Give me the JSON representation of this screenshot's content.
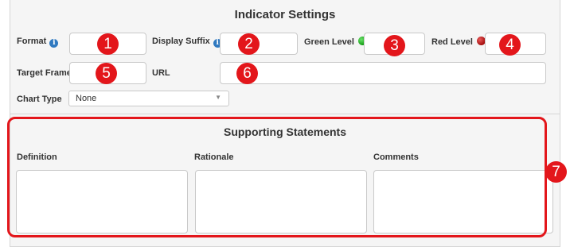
{
  "indicator_settings": {
    "title": "Indicator Settings",
    "fields": {
      "format": {
        "label": "Format",
        "value": ""
      },
      "display_suffix": {
        "label": "Display Suffix",
        "value": ""
      },
      "green_level": {
        "label": "Green Level",
        "value": ""
      },
      "red_level": {
        "label": "Red Level",
        "value": ""
      },
      "target_frame": {
        "label": "Target Frame",
        "value": ""
      },
      "url": {
        "label": "URL",
        "value": ""
      },
      "chart_type": {
        "label": "Chart Type",
        "selected": "None"
      }
    }
  },
  "supporting_statements": {
    "title": "Supporting Statements",
    "columns": [
      {
        "label": "Definition",
        "value": ""
      },
      {
        "label": "Rationale",
        "value": ""
      },
      {
        "label": "Comments",
        "value": ""
      }
    ]
  },
  "callouts": [
    "1",
    "2",
    "3",
    "4",
    "5",
    "6",
    "7"
  ],
  "icons": {
    "info": "info-icon",
    "green": "green-dot-icon",
    "red": "red-dot-icon",
    "dropdown": "chevron-down-icon"
  },
  "colors": {
    "callout": "#e3161b",
    "green_level": "#129a12",
    "red_level": "#a30d0d",
    "info": "#2f79c0"
  }
}
